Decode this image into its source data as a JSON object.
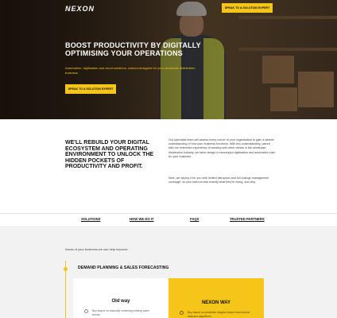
{
  "header": {
    "logo_text": "NEXON",
    "cta_label": "SPEAK TO A SOLUTION EXPERT"
  },
  "hero": {
    "title": "BOOST PRODUCTIVITY BY DIGITALLY OPTIMISING YOUR OPERATIONS",
    "subtitle": "Automation, digitisation and cloud solutions, custom-designed for your wholesale distribution business.",
    "cta_label": "SPEAK TO A SOLUTION EXPERT"
  },
  "intro": {
    "heading": "WE'LL REBUILD YOUR DIGITAL ECOSYSTEM AND OPERATING ENVIRONMENT TO UNLOCK THE HIDDEN POCKETS OF PRODUCTIVITY AND PROFIT.",
    "paragraph_1": "Our specialist team will assess every corner of your organisation to gain a deeper understanding of how your business functions. With this understanding, paired with our extensive experience of working with other clients in the wholesale distribution industry, we tailor-design a meaningful digitisation and automation plan for your business.",
    "paragraph_2": "Next, we deploy it for you with limited disruption and full change management coverage, so your team knows exactly what they're doing, and why."
  },
  "tabs": [
    {
      "label": "SOLUTIONS"
    },
    {
      "label": "HOW WE DO IT"
    },
    {
      "label": "FAQS"
    },
    {
      "label": "TRUSTED PARTNERS"
    }
  ],
  "areas": {
    "intro_text": "Areas of your business we can help improve:",
    "section_title": "DEMAND PLANNING & SALES FORECASTING",
    "old_way": {
      "title": "Old way",
      "text": "Buy based on manually reviewing existing sales trends."
    },
    "nexon_way": {
      "title": "NEXON WAY",
      "text": "Buy based on predictive insights drawn from historic data and algorithms."
    }
  },
  "colors": {
    "accent": "#f5c518",
    "hero_overlay": "#14100a",
    "text_dark": "#111111",
    "panel_bg": "#f2f2f2"
  }
}
